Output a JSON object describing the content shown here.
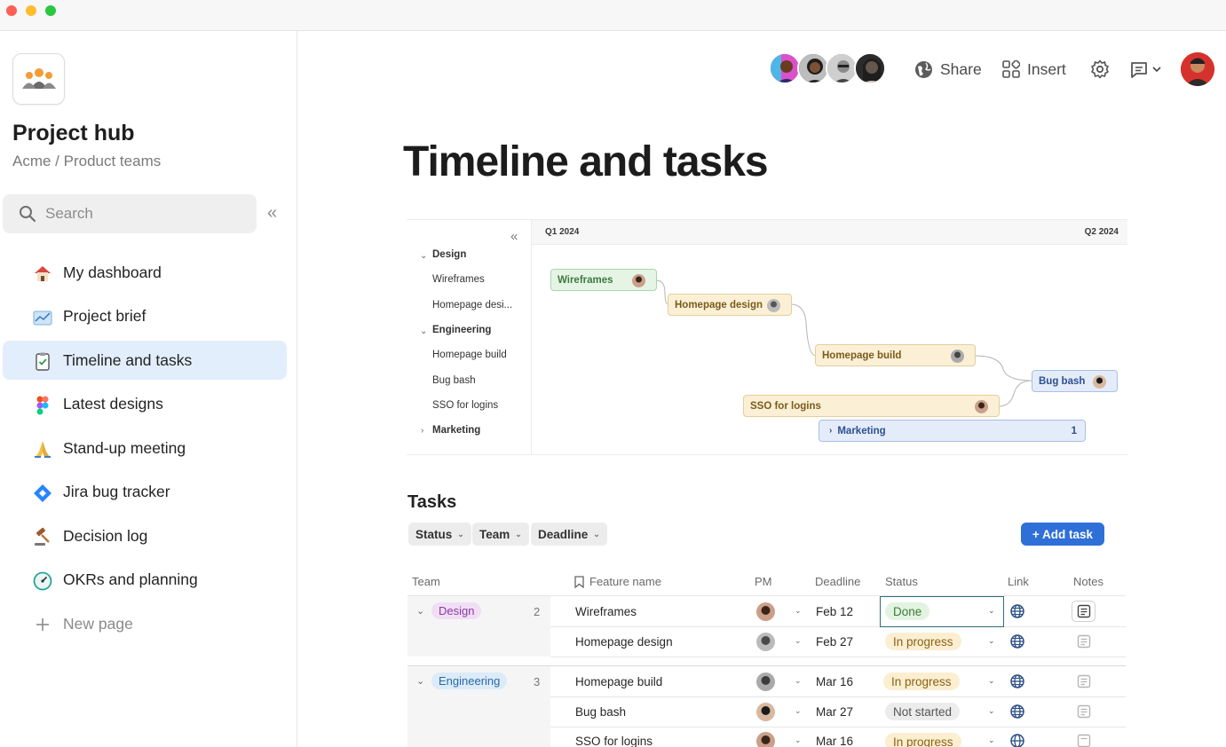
{
  "sidebar": {
    "workspace_title": "Project hub",
    "breadcrumb": "Acme / Product teams",
    "search_placeholder": "Search",
    "items": [
      {
        "label": "My dashboard",
        "icon": "house-icon",
        "active": false
      },
      {
        "label": "Project brief",
        "icon": "chart-icon",
        "active": false
      },
      {
        "label": "Timeline and tasks",
        "icon": "clipboard-check-icon",
        "active": true
      },
      {
        "label": "Latest designs",
        "icon": "figma-icon",
        "active": false
      },
      {
        "label": "Stand-up meeting",
        "icon": "praying-hands-icon",
        "active": false
      },
      {
        "label": "Jira bug tracker",
        "icon": "jira-icon",
        "active": false
      },
      {
        "label": "Decision log",
        "icon": "gavel-icon",
        "active": false
      },
      {
        "label": "OKRs and planning",
        "icon": "gauge-icon",
        "active": false
      }
    ],
    "new_page_label": "New page"
  },
  "toolbar": {
    "share_label": "Share",
    "insert_label": "Insert"
  },
  "page": {
    "title": "Timeline and tasks"
  },
  "timeline": {
    "quarters": [
      "Q1 2024",
      "Q2 2024"
    ],
    "groups": [
      {
        "name": "Design",
        "expanded": true,
        "tasks": [
          "Wireframes",
          "Homepage desi..."
        ]
      },
      {
        "name": "Engineering",
        "expanded": true,
        "tasks": [
          "Homepage build",
          "Bug bash",
          "SSO for logins"
        ]
      },
      {
        "name": "Marketing",
        "expanded": false,
        "tasks": []
      }
    ],
    "bars": [
      {
        "label": "Wireframes",
        "color": "green"
      },
      {
        "label": "Homepage design",
        "color": "yellow"
      },
      {
        "label": "Homepage build",
        "color": "yellow"
      },
      {
        "label": "Bug bash",
        "color": "blue"
      },
      {
        "label": "SSO for logins",
        "color": "yellow"
      },
      {
        "label": "Marketing",
        "color": "blue",
        "count": "1"
      }
    ]
  },
  "tasks": {
    "title": "Tasks",
    "filters": [
      "Status",
      "Team",
      "Deadline"
    ],
    "add_label": "+ Add task",
    "columns": [
      "Team",
      "Feature name",
      "PM",
      "Deadline",
      "Status",
      "Link",
      "Notes"
    ],
    "groups": [
      {
        "team": "Design",
        "count": "2",
        "pill_bg": "#f1def5",
        "pill_fg": "#8a3d9d",
        "rows": [
          {
            "feature": "Wireframes",
            "deadline": "Feb 12",
            "status": "Done",
            "status_kind": "done"
          },
          {
            "feature": "Homepage design",
            "deadline": "Feb 27",
            "status": "In progress",
            "status_kind": "prog"
          }
        ]
      },
      {
        "team": "Engineering",
        "count": "3",
        "pill_bg": "#dcebf8",
        "pill_fg": "#2a6aa6",
        "rows": [
          {
            "feature": "Homepage build",
            "deadline": "Mar 16",
            "status": "In progress",
            "status_kind": "prog"
          },
          {
            "feature": "Bug bash",
            "deadline": "Mar 27",
            "status": "Not started",
            "status_kind": "not"
          },
          {
            "feature": "SSO for logins",
            "deadline": "Mar 16",
            "status": "In progress",
            "status_kind": "prog"
          }
        ]
      }
    ]
  },
  "colors": {
    "accent": "#2f6fd8",
    "active_nav": "#e2eefb"
  }
}
